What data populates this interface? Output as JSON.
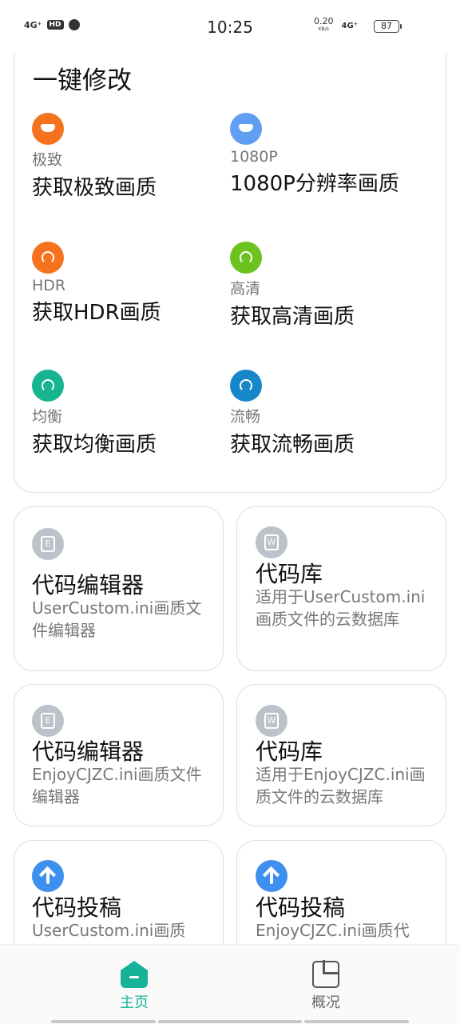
{
  "status_bar": {
    "network_left": "4G⁺",
    "hd_badge": "HD",
    "time": "10:25",
    "speed_value": "0.20",
    "speed_unit": "KB/s",
    "network_right": "4G⁺",
    "battery": "87"
  },
  "quick_modify": {
    "title": "一键修改",
    "modes": [
      {
        "sub": "极致",
        "main": "获取极致画质",
        "color": "#f5731f",
        "icon": "monitor-icon"
      },
      {
        "sub": "1080P",
        "main": "1080P分辨率画质",
        "color": "#5f9ef0",
        "icon": "monitor-icon"
      },
      {
        "sub": "HDR",
        "main": "获取HDR画质",
        "color": "#f5731f",
        "icon": "gauge-icon"
      },
      {
        "sub": "高清",
        "main": "获取高清画质",
        "color": "#6cc31f",
        "icon": "gauge-icon"
      },
      {
        "sub": "均衡",
        "main": "获取均衡画质",
        "color": "#16b591",
        "icon": "gauge-icon"
      },
      {
        "sub": "流畅",
        "main": "获取流畅画质",
        "color": "#1687c9",
        "icon": "gauge-icon"
      }
    ]
  },
  "tiles": [
    {
      "icon_letter": "E",
      "title": "代码编辑器",
      "desc": "UserCustom.ini画质文件编辑器"
    },
    {
      "icon_letter": "W",
      "title": "代码库",
      "desc": "适用于UserCustom.ini画质文件的云数据库"
    },
    {
      "icon_letter": "E",
      "title": "代码编辑器",
      "desc": "EnjoyCJZC.ini画质文件编辑器"
    },
    {
      "icon_letter": "W",
      "title": "代码库",
      "desc": "适用于EnjoyCJZC.ini画质文件的云数据库"
    },
    {
      "icon_letter": "",
      "title": "代码投稿",
      "desc": "UserCustom.ini画质"
    },
    {
      "icon_letter": "",
      "title": "代码投稿",
      "desc": "EnjoyCJZC.ini画质代"
    }
  ],
  "bottom_nav": {
    "home_label": "主页",
    "overview_label": "概况",
    "accent": "#18b29a"
  }
}
